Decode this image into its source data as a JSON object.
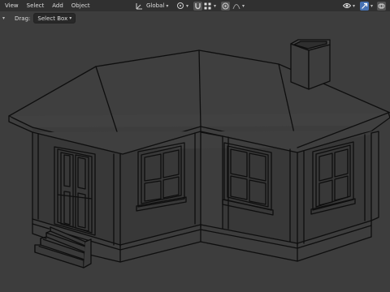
{
  "menu": {
    "items": [
      "View",
      "Select",
      "Add",
      "Object"
    ]
  },
  "transform": {
    "orientation_label": "Global"
  },
  "tool_settings": {
    "drag_label": "Drag:",
    "drag_value": "Select Box"
  },
  "icons": {
    "orientation": "transform-orientation-icon",
    "pivot": "pivot-point-icon",
    "snap": "magnet-snap-icon",
    "snap_target": "snap-grid-icon",
    "proportional": "proportional-editing-icon",
    "falloff": "falloff-curve-icon",
    "visibility": "eye-visibility-icon",
    "gizmo": "gizmo-toggle-icon",
    "overlay": "overlay-icon",
    "collapse": "chevron-down-icon"
  },
  "colors": {
    "header_bg": "#303030",
    "viewport_bg": "#3d3d3d",
    "accent": "#4772b3",
    "wire": "#0e0e0e"
  }
}
